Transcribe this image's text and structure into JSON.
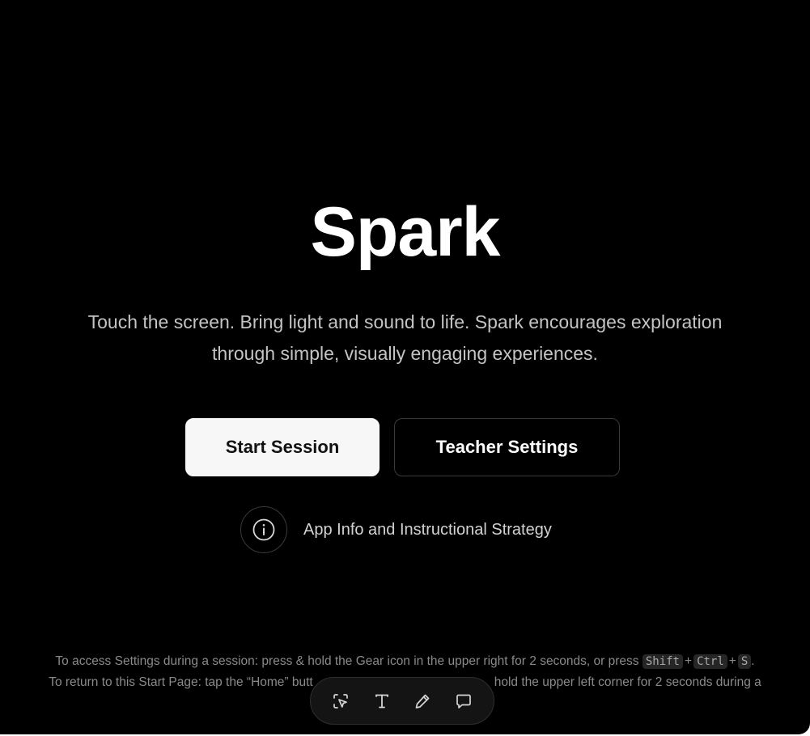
{
  "hero": {
    "title": "Spark",
    "tagline_line1": "Touch the screen. Bring light and sound to life. Spark encourages exploration",
    "tagline_line2": "through simple, visually engaging experiences."
  },
  "actions": {
    "start_label": "Start Session",
    "settings_label": "Teacher Settings"
  },
  "info": {
    "icon": "info-icon",
    "label": "App Info and Instructional Strategy"
  },
  "footer": {
    "line1_text": "To access Settings during a session: press & hold the Gear icon in the upper right for 2 seconds, or press",
    "keys": [
      "Shift",
      "Ctrl",
      "S"
    ],
    "key_separator": "+",
    "line1_end": ".",
    "line2_text": "To return to this Start Page: tap the “Home” butt",
    "line2_tail": "hold the upper left corner for 2 seconds during a"
  },
  "toolbar": {
    "tools": [
      "select-icon",
      "text-icon",
      "pencil-icon",
      "comment-icon"
    ]
  },
  "colors": {
    "background": "#000000",
    "primary_button": "#f7f7f7",
    "text_muted": "#c4c4c4"
  }
}
